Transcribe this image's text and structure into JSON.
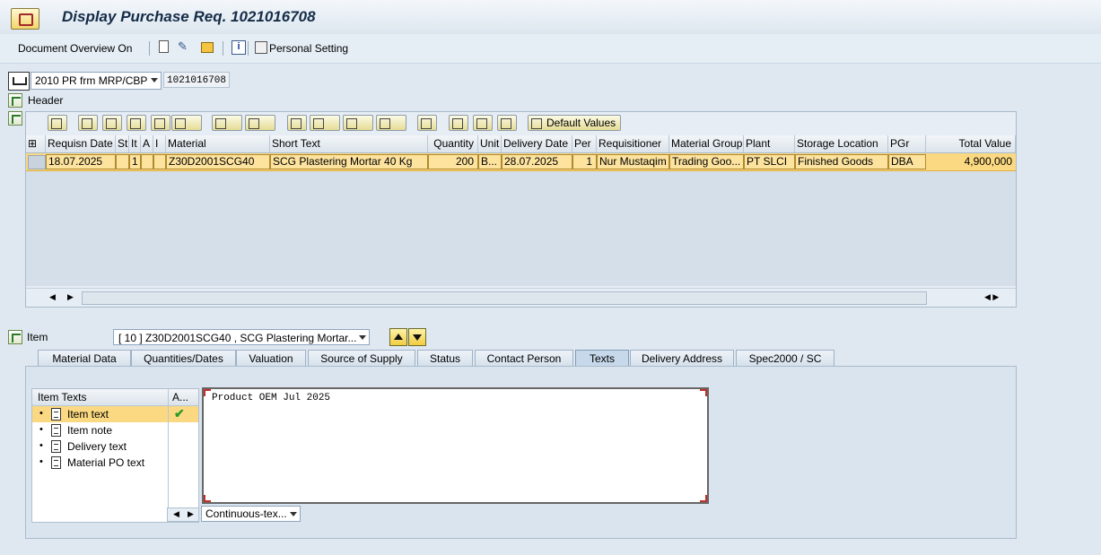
{
  "window": {
    "title": "Display Purchase Req. 1021016708"
  },
  "toolbar": {
    "document_overview_label": "Document Overview On",
    "personal_setting_label": "Personal Setting",
    "icons": [
      "new-document-icon",
      "display-glasses-icon",
      "envelope-icon",
      "info-icon",
      "personal-setting-icon"
    ]
  },
  "doc": {
    "type_value": "2010 PR frm MRP/CBP",
    "number": "1021016708"
  },
  "header": {
    "label": "Header"
  },
  "grid": {
    "default_values_label": "Default Values",
    "columns": [
      "Requisn Date",
      "St",
      "It",
      "A",
      "I",
      "Material",
      "Short Text",
      "Quantity",
      "Unit",
      "Delivery Date",
      "Per",
      "Requisitioner",
      "Material Group",
      "Plant",
      "Storage Location",
      "PGr",
      "Total Value"
    ],
    "rows": [
      [
        "18.07.2025",
        "",
        "1",
        "",
        "",
        "Z30D2001SCG40",
        "SCG Plastering Mortar 40 Kg",
        "200",
        "B...",
        "28.07.2025",
        "1",
        "Nur Mustaqim",
        "Trading Goo...",
        "PT SLCI",
        "Finished Goods",
        "DBA",
        "4,900,000"
      ]
    ]
  },
  "item": {
    "label": "Item",
    "selected_value": "[ 10 ] Z30D2001SCG40 , SCG Plastering Mortar..."
  },
  "tabs": [
    {
      "label": "Material Data"
    },
    {
      "label": "Quantities/Dates"
    },
    {
      "label": "Valuation"
    },
    {
      "label": "Source of Supply"
    },
    {
      "label": "Status"
    },
    {
      "label": "Contact Person"
    },
    {
      "label": "Texts",
      "active": true
    },
    {
      "label": "Delivery Address"
    },
    {
      "label": "Spec2000 / SC"
    }
  ],
  "texts": {
    "tree_header": "Item Texts",
    "tree_header_col2": "A...",
    "items": [
      "Item text",
      "Item note",
      "Delivery text",
      "Material PO text"
    ],
    "editor_content": "Product OEM Jul 2025",
    "format_value": "Continuous-tex..."
  },
  "colors": {
    "selection": "#fbd982",
    "title": "#152c47",
    "panel": "#dae4ee"
  }
}
